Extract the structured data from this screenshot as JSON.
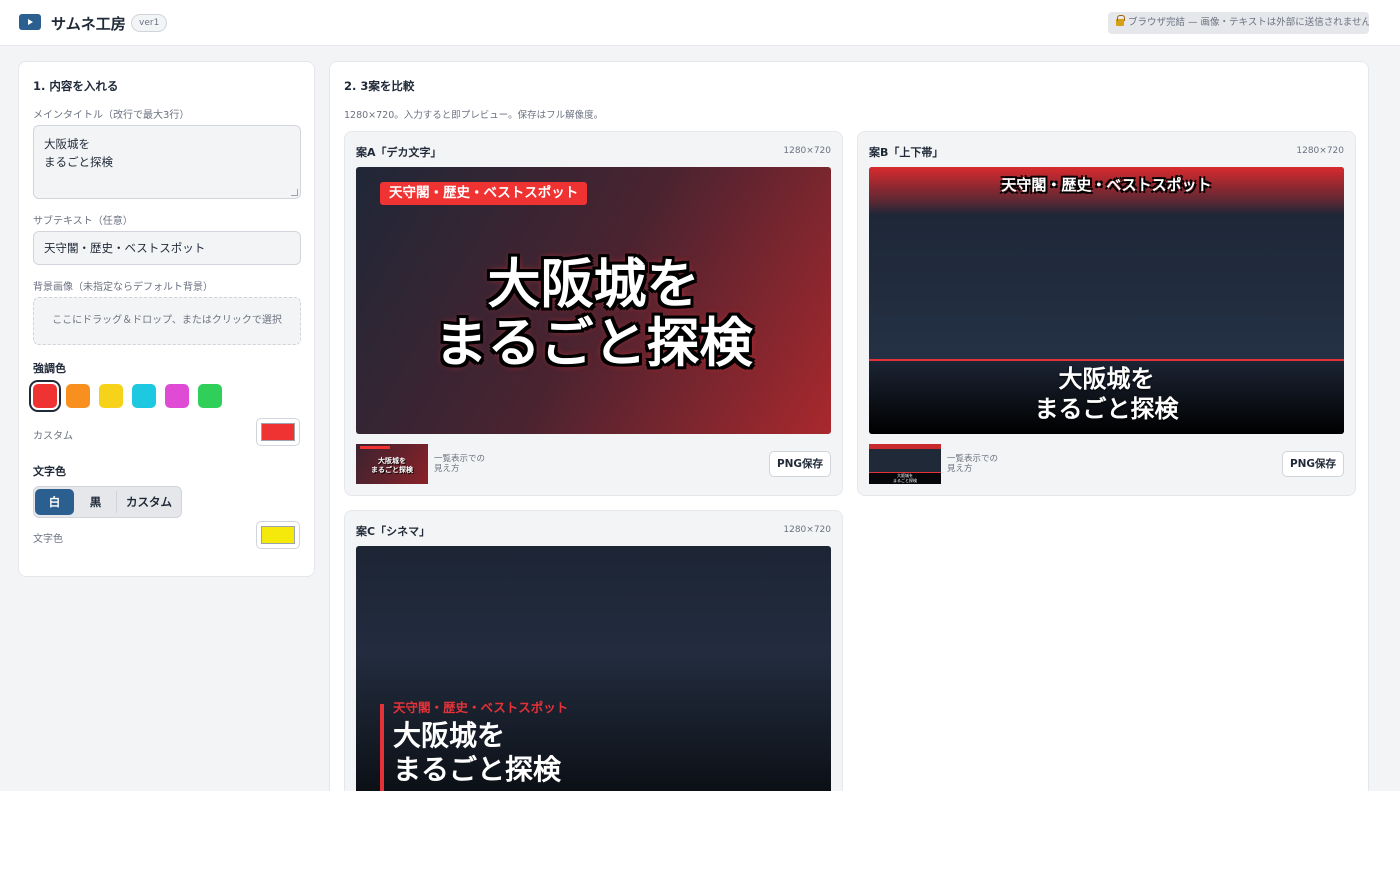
{
  "header": {
    "app_title": "サムネ工房",
    "version": "ver1",
    "privacy_note": "ブラウザ完結 — 画像・テキストは外部に送信されません"
  },
  "input_panel": {
    "section_title": "1. 内容を入れる",
    "main_title_label": "メインタイトル（改行で最大3行）",
    "main_title_value": "大阪城を\nまるごと探検",
    "subtext_label": "サブテキスト（任意）",
    "subtext_value": "天守閣・歴史・ベストスポット",
    "bg_image_label": "背景画像（未指定ならデフォルト背景）",
    "dropzone_text": "ここにドラッグ＆ドロップ、またはクリックで選択",
    "accent_label": "強調色",
    "accent_swatches": [
      "#ef3333",
      "#f7901e",
      "#f7d21a",
      "#1ec8e0",
      "#e04bd6",
      "#2fcf5a"
    ],
    "accent_selected_index": 0,
    "custom_label": "カスタム",
    "custom_accent_color": "#ef3333",
    "text_color_label": "文字色",
    "text_color_options": [
      "白",
      "黒",
      "カスタム"
    ],
    "text_color_selected_index": 0,
    "text_color_field_label": "文字色",
    "text_color_value": "#f5e90c"
  },
  "compare_panel": {
    "section_title": "2. 3案を比較",
    "hint": "1280×720。入力すると即プレビュー。保存はフル解像度。",
    "thumb_caption": "一覧表示での\n見え方",
    "save_label": "PNG保存",
    "designs": [
      {
        "title": "案A「デカ文字」",
        "size": "1280×720"
      },
      {
        "title": "案B「上下帯」",
        "size": "1280×720"
      },
      {
        "title": "案C「シネマ」",
        "size": "1280×720"
      }
    ]
  },
  "colors": {
    "primary": "#2a5f8f",
    "accent": "#ef3333"
  }
}
